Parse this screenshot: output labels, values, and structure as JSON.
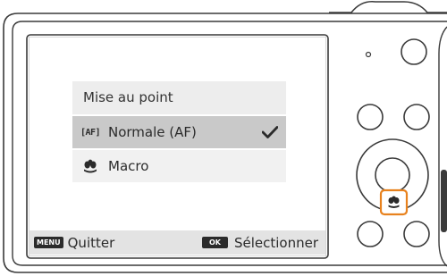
{
  "menu": {
    "title": "Mise au point",
    "items": [
      {
        "icon": "af-normal-icon",
        "icon_text": "[AF]",
        "label": "Normale (AF)",
        "selected": true,
        "checked": true
      },
      {
        "icon": "macro-flower-icon",
        "label": "Macro",
        "selected": false,
        "checked": false
      }
    ]
  },
  "footer": {
    "menu_key": "MENU",
    "menu_label": "Quitter",
    "ok_key": "OK",
    "ok_label": "Sélectionner"
  },
  "colors": {
    "highlight": "#e8821e",
    "selected_row": "#c9c9c9",
    "bar": "#e3e3e3",
    "outline": "#3a3a3a"
  }
}
